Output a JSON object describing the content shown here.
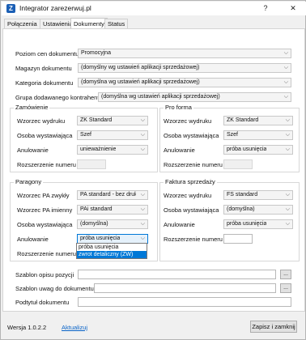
{
  "window": {
    "title": "Integrator zarezerwuj.pl",
    "app_icon_letter": "Z",
    "help_glyph": "?",
    "close_glyph": "✕"
  },
  "tabs": [
    {
      "label": "Połączenia"
    },
    {
      "label": "Ustawienia"
    },
    {
      "label": "Dokumenty"
    },
    {
      "label": "Status"
    }
  ],
  "general": {
    "poziom_cen": {
      "label": "Poziom cen dokumentu",
      "value": "Promocyjna"
    },
    "magazyn": {
      "label": "Magazyn dokumentu",
      "value": "(domyślny wg ustawień aplikacji sprzedażowej)"
    },
    "kategoria": {
      "label": "Kategoria dokumentu",
      "value": "(domyślna wg ustawień aplikacji sprzedażowej)"
    },
    "grupa": {
      "label": "Grupa dodawanego kontrahenta",
      "value": "(domyślna wg ustawień aplikacji sprzedażowej)"
    }
  },
  "zamowienie": {
    "title": "Zamówienie",
    "wzorzec": {
      "label": "Wzorzec wydruku",
      "value": "ZK Standard"
    },
    "osoba": {
      "label": "Osoba wystawiająca",
      "value": "Szef"
    },
    "anulowanie": {
      "label": "Anulowanie",
      "value": "unieważnienie"
    },
    "rozszerzenie": {
      "label": "Rozszerzenie numeru",
      "value": ""
    }
  },
  "proforma": {
    "title": "Pro forma",
    "wzorzec": {
      "label": "Wzorzec wydruku",
      "value": "ZK Standard"
    },
    "osoba": {
      "label": "Osoba wystawiająca",
      "value": "Szef"
    },
    "anulowanie": {
      "label": "Anulowanie",
      "value": "próba usunięcia"
    },
    "rozszerzenie": {
      "label": "Rozszerzenie numeru",
      "value": ""
    }
  },
  "paragony": {
    "title": "Paragony",
    "wzorzec_pa_zwykly": {
      "label": "Wzorzec PA zwykły",
      "value": "PA standard - bez druk"
    },
    "wzorzec_pa_imienny": {
      "label": "Wzorzec PA imienny",
      "value": "PAi standard"
    },
    "osoba": {
      "label": "Osoba wystawiająca",
      "value": "(domyślna)"
    },
    "anulowanie": {
      "label": "Anulowanie",
      "value": "próba usunięcia",
      "options": [
        "próba usunięcia",
        "zwrot detaliczny (ZW)"
      ]
    },
    "rozszerzenie": {
      "label": "Rozszerzenie numeru",
      "value": ""
    }
  },
  "faktura": {
    "title": "Faktura sprzedaży",
    "wzorzec": {
      "label": "Wzorzec wydruku",
      "value": "FS standard"
    },
    "osoba": {
      "label": "Osoba wystawiająca",
      "value": "(domyślna)"
    },
    "anulowanie": {
      "label": "Anulowanie",
      "value": "próba usunięcia"
    },
    "rozszerzenie": {
      "label": "Rozszerzenie numeru",
      "value": ""
    }
  },
  "templates": {
    "szablon_opisu": {
      "label": "Szablon opisu pozycji",
      "value": ""
    },
    "szablon_uwag": {
      "label": "Szablon uwag do dokumentu",
      "value": ""
    },
    "podtytul": {
      "label": "Podtytuł dokumentu",
      "value": ""
    },
    "dots_label": "..."
  },
  "footer": {
    "version": "Wersja 1.0.2.2",
    "update_link": "Aktualizuj",
    "close_button": "Zapisz i zamknij"
  }
}
